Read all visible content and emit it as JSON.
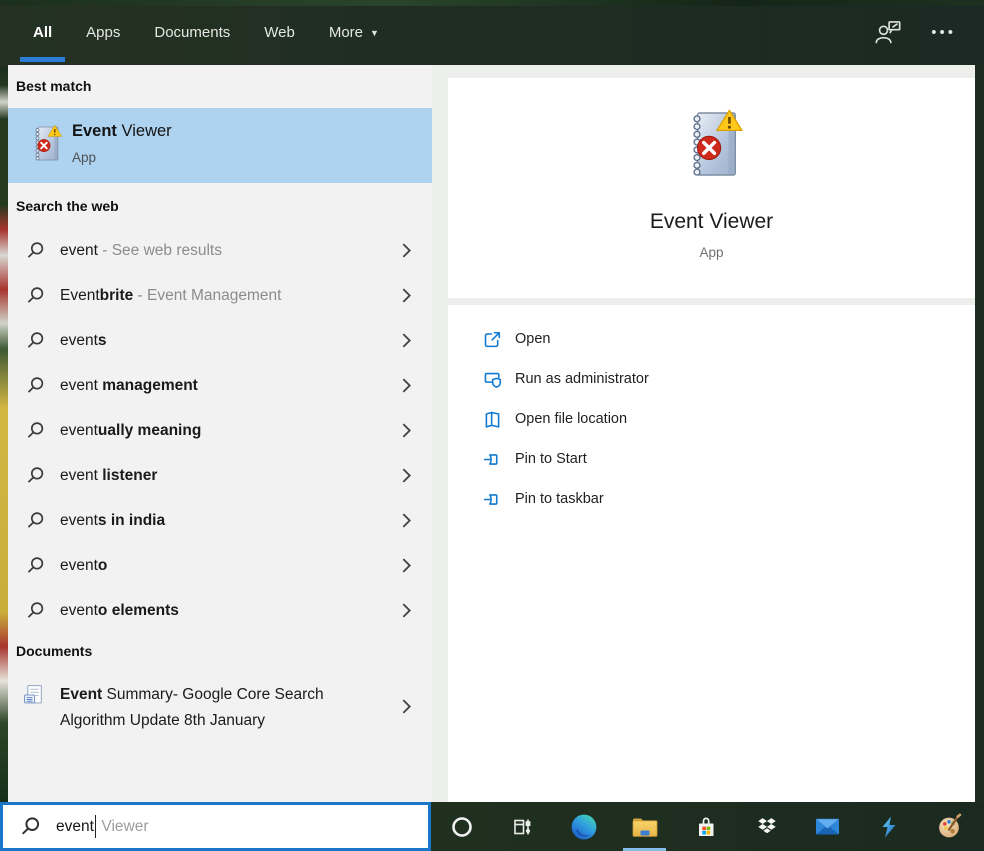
{
  "topbar": {
    "tabs": [
      {
        "label": "All"
      },
      {
        "label": "Apps"
      },
      {
        "label": "Documents"
      },
      {
        "label": "Web"
      },
      {
        "label": "More"
      }
    ],
    "more_caret": "▼",
    "ellipsis": "•••"
  },
  "left_panel": {
    "best_match_header": "Best match",
    "best_match": {
      "name_bold": "Event",
      "name_rest": " Viewer",
      "type": "App"
    },
    "web_header": "Search the web",
    "suggestions": [
      {
        "pre": "event",
        "bold": "",
        "suffix": " - See web results"
      },
      {
        "pre": "Event",
        "bold": "brite",
        "suffix": " - Event Management"
      },
      {
        "pre": "event",
        "bold": "s",
        "suffix": ""
      },
      {
        "pre": "event ",
        "bold": "management",
        "suffix": ""
      },
      {
        "pre": "event",
        "bold": "ually meaning",
        "suffix": ""
      },
      {
        "pre": "event ",
        "bold": "listener",
        "suffix": ""
      },
      {
        "pre": "event",
        "bold": "s in india",
        "suffix": ""
      },
      {
        "pre": "event",
        "bold": "o",
        "suffix": ""
      },
      {
        "pre": "event",
        "bold": "o elements",
        "suffix": ""
      }
    ],
    "documents_header": "Documents",
    "document_item": {
      "bold": "Event",
      "rest": " Summary- Google Core Search Algorithm Update 8th January"
    }
  },
  "right_panel": {
    "app_name": "Event Viewer",
    "app_type": "App",
    "actions": [
      {
        "label": "Open"
      },
      {
        "label": "Run as administrator"
      },
      {
        "label": "Open file location"
      },
      {
        "label": "Pin to Start"
      },
      {
        "label": "Pin to taskbar"
      }
    ]
  },
  "search_bar": {
    "typed": "event",
    "suggestion": "Viewer"
  },
  "taskbar": {
    "icons": [
      "cortana",
      "task-view",
      "edge",
      "file-explorer",
      "store",
      "dropbox",
      "mail",
      "lightning-app",
      "paint"
    ],
    "active_icon": "file-explorer"
  },
  "colors": {
    "accent_blue": "#2b7cd6",
    "highlight_blue": "#aed3f0",
    "action_blue": "#1079d1",
    "search_border": "#1976c8",
    "topbar_green": "#1e2c21"
  }
}
